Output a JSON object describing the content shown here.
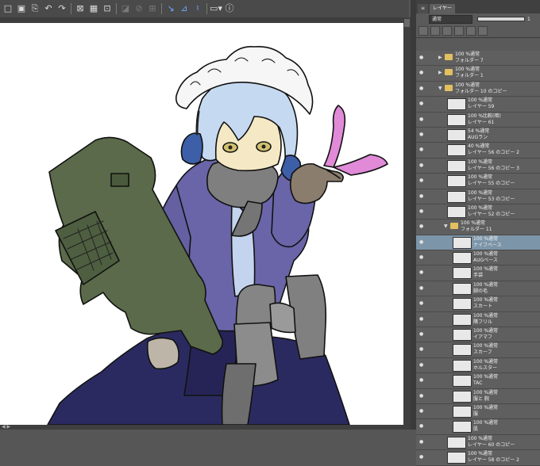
{
  "toolbar": {
    "icons": [
      "new-icon",
      "open-icon",
      "save-icon",
      "undo-icon",
      "redo-icon",
      "clear-icon",
      "transform-icon",
      "select-icon",
      "fill-icon",
      "flip-icon",
      "paint-icon",
      "snap-icon",
      "ruler-icon",
      "guide-icon",
      "view-dropdown-icon",
      "info-icon"
    ]
  },
  "panel": {
    "tabs": [
      "レイヤー"
    ],
    "blend_mode": "通常",
    "opacity_value": "1"
  },
  "layers": [
    {
      "indent": 0,
      "folder": true,
      "expanded": false,
      "blend": "100 %通常",
      "name": "フォルダー 7"
    },
    {
      "indent": 0,
      "folder": true,
      "expanded": false,
      "blend": "100 %通常",
      "name": "フォルダー 1"
    },
    {
      "indent": 0,
      "folder": true,
      "expanded": true,
      "blend": "100 %通常",
      "name": "フォルダー 10 のコピー"
    },
    {
      "indent": 1,
      "folder": false,
      "blend": "100 %通常",
      "name": "レイヤー 59"
    },
    {
      "indent": 1,
      "folder": false,
      "blend": "100 %比較(暗)",
      "name": "レイヤー 61"
    },
    {
      "indent": 1,
      "folder": false,
      "blend": "54 %通常",
      "name": "AUGラン"
    },
    {
      "indent": 1,
      "folder": false,
      "blend": "40 %通常",
      "name": "レイヤー 56 のコピー 2"
    },
    {
      "indent": 1,
      "folder": false,
      "blend": "100 %通常",
      "name": "レイヤー 56 のコピー 3"
    },
    {
      "indent": 1,
      "folder": false,
      "blend": "100 %通常",
      "name": "レイヤー 55 のコピー"
    },
    {
      "indent": 1,
      "folder": false,
      "blend": "100 %通常",
      "name": "レイヤー 53 のコピー"
    },
    {
      "indent": 1,
      "folder": false,
      "blend": "100 %通常",
      "name": "レイヤー 52 のコピー"
    },
    {
      "indent": 1,
      "folder": true,
      "expanded": true,
      "blend": "100 %通常",
      "name": "フォルダー 11"
    },
    {
      "indent": 2,
      "folder": false,
      "blend": "100 %通常",
      "name": "ナイフベース",
      "selected": true
    },
    {
      "indent": 2,
      "folder": false,
      "blend": "100 %通常",
      "name": "AUGベース"
    },
    {
      "indent": 2,
      "folder": false,
      "blend": "100 %通常",
      "name": "手袋"
    },
    {
      "indent": 2,
      "folder": false,
      "blend": "100 %通常",
      "name": "脚の毛"
    },
    {
      "indent": 2,
      "folder": false,
      "blend": "100 %通常",
      "name": "スカート"
    },
    {
      "indent": 2,
      "folder": false,
      "blend": "100 %通常",
      "name": "隣フリル"
    },
    {
      "indent": 2,
      "folder": false,
      "blend": "100 %通常",
      "name": "イアマフ"
    },
    {
      "indent": 2,
      "folder": false,
      "blend": "100 %通常",
      "name": "スカーフ"
    },
    {
      "indent": 2,
      "folder": false,
      "blend": "100 %通常",
      "name": "ホルスター"
    },
    {
      "indent": 2,
      "folder": false,
      "blend": "100 %通常",
      "name": "TAC"
    },
    {
      "indent": 2,
      "folder": false,
      "blend": "100 %通常",
      "name": "服と 腕"
    },
    {
      "indent": 2,
      "folder": false,
      "blend": "100 %通常",
      "name": "服"
    },
    {
      "indent": 2,
      "folder": false,
      "blend": "100 %通常",
      "name": "肌"
    },
    {
      "indent": 1,
      "folder": false,
      "blend": "100 %通常",
      "name": "レイヤー 60 のコピー"
    },
    {
      "indent": 1,
      "folder": false,
      "blend": "100 %通常",
      "name": "レイヤー 58 のコピー 2"
    }
  ],
  "colors": {
    "panel_bg": "#5f5f5f",
    "selected_row": "#7d95a8",
    "skin": "#f4e9c4",
    "hair": "#c5d9f0",
    "sweater": "#6a65a8",
    "scarf": "#7f7f7f",
    "rifle": "#5a6a4a",
    "pouch": "#858585",
    "skirt": "#2b2a60",
    "gloves": "#8a7d6d",
    "earmuff": "#3d5fa8",
    "knife": "#e08ad8"
  }
}
